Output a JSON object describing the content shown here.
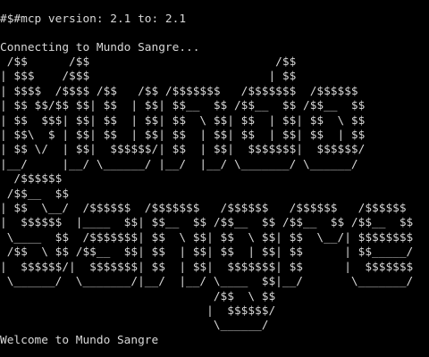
{
  "terminal": {
    "version_line": "#$#mcp version: 2.1 to: 2.1",
    "connecting_line": "Connecting to Mundo Sangre...",
    "banner_mundo": " /$$      /$$                           /$$          \n| $$$    /$$$                          | $$          \n| $$$$  /$$$$ /$$   /$$ /$$$$$$$   /$$$$$$$  /$$$$$$ \n| $$ $$/$$ $$| $$  | $$| $$__  $$ /$$__  $$ /$$__  $$\n| $$  $$$| $$| $$  | $$| $$  \\ $$| $$  | $$| $$  \\ $$\n| $$\\  $ | $$| $$  | $$| $$  | $$| $$  | $$| $$  | $$\n| $$ \\/  | $$|  $$$$$$/| $$  | $$|  $$$$$$$|  $$$$$$/\n|__/     |__/ \\______/ |__/  |__/ \\_______/ \\______/ ",
    "banner_sangre": "  /$$$$$$                                                \n /$$__  $$                                               \n| $$  \\__/  /$$$$$$  /$$$$$$$   /$$$$$$   /$$$$$$   /$$$$$$ \n|  $$$$$$  |____  $$| $$__  $$ /$$__  $$ /$$__  $$ /$$__  $$\n \\____  $$  /$$$$$$$| $$  \\ $$| $$  \\ $$| $$  \\__/| $$$$$$$$\n /$$  \\ $$ /$$__  $$| $$  | $$| $$  | $$| $$      | $$_____/\n|  $$$$$$/|  $$$$$$$| $$  | $$|  $$$$$$$| $$      |  $$$$$$$\n \\______/  \\_______/|__/  |__/ \\____  $$|__/       \\_______/\n                               /$$  \\ $$                    \n                              |  $$$$$$/                    \n                               \\______/                     ",
    "welcome_line": "Welcome to Mundo Sangre"
  }
}
